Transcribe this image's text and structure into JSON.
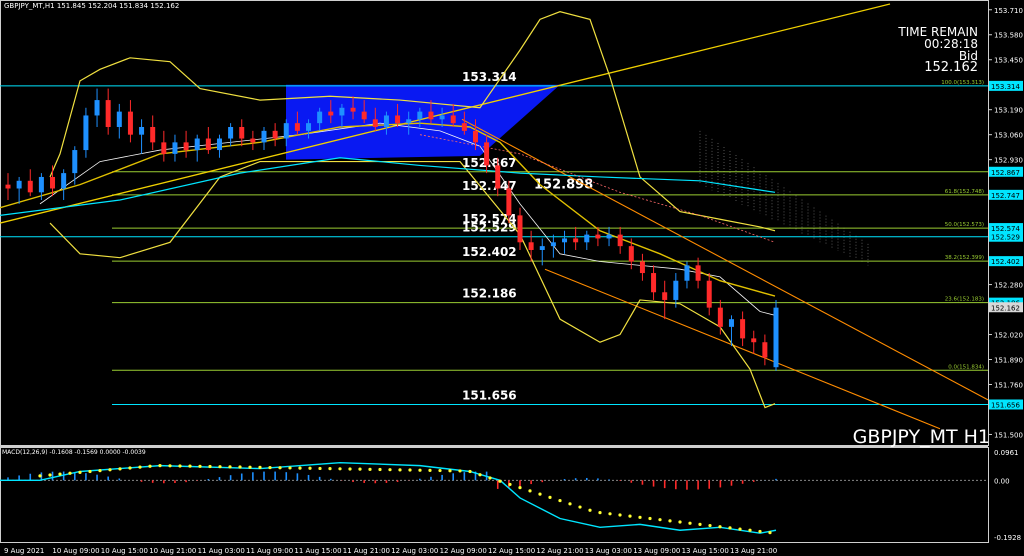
{
  "header": {
    "symbol_info": "GBPJPY_MT,H1  151.845 152.204 151.834 152.162"
  },
  "time_remain": {
    "label": "TIME REMAIN",
    "value": "00:28:18",
    "bid_label": "Bid",
    "bid_value": "152.162"
  },
  "symbol_title": "GBPJPY_MT H1",
  "price_callout": "152.898",
  "macd_header": "MACD(12,26,9) -0.1608 -0.1569 0.0000 -0.0039",
  "colors": {
    "background": "#000000",
    "bull_candle": "#1e90ff",
    "bear_candle": "#ff2a2a",
    "bollinger": "#f0e040",
    "level_line": "#9acd32",
    "cyan_line": "#00e5ff",
    "blue_zone": "#0a1aff",
    "trend_orange": "#ff8c00"
  },
  "chart_data": {
    "type": "candlestick",
    "price_axis": {
      "labels": [
        "153.710",
        "153.580",
        "153.450",
        "153.314",
        "153.190",
        "153.060",
        "152.930",
        "152.867",
        "152.747",
        "152.574",
        "152.529",
        "152.402",
        "152.280",
        "152.186",
        "152.020",
        "151.890",
        "151.760",
        "151.656",
        "151.500"
      ],
      "range": [
        151.44,
        153.74
      ]
    },
    "time_axis": [
      "9 Aug 2021",
      "10 Aug 09:00",
      "10 Aug 15:00",
      "10 Aug 21:00",
      "11 Aug 03:00",
      "11 Aug 09:00",
      "11 Aug 15:00",
      "11 Aug 21:00",
      "12 Aug 03:00",
      "12 Aug 09:00",
      "12 Aug 15:00",
      "12 Aug 21:00",
      "13 Aug 03:00",
      "13 Aug 09:00",
      "13 Aug 15:00",
      "13 Aug 21:00"
    ],
    "horizontal_levels": [
      {
        "value": 153.314,
        "label": "153.314",
        "color": "#00e5ff"
      },
      {
        "value": 152.867,
        "label": "152.867",
        "color": "#9acd32"
      },
      {
        "value": 152.747,
        "label": "152.747",
        "color": "#9acd32"
      },
      {
        "value": 152.574,
        "label": "152.574",
        "color": "#9acd32"
      },
      {
        "value": 152.529,
        "label": "152.529",
        "color": "#00e5ff"
      },
      {
        "value": 152.402,
        "label": "152.402",
        "color": "#9acd32"
      },
      {
        "value": 152.186,
        "label": "152.186",
        "color": "#9acd32"
      },
      {
        "value": 151.834,
        "label": "",
        "color": "#9acd32"
      },
      {
        "value": 151.656,
        "label": "151.656",
        "color": "#00e5ff"
      }
    ],
    "fib_labels": [
      {
        "value": 153.314,
        "label": "100.0(153.313)"
      },
      {
        "value": 152.747,
        "label": "61.8(152.748)"
      },
      {
        "value": 152.574,
        "label": "50.0(152.573)"
      },
      {
        "value": 152.402,
        "label": "38.2(152.399)"
      },
      {
        "value": 152.186,
        "label": "23.6(152.183)"
      },
      {
        "value": 151.834,
        "label": "0.0(151.834)"
      }
    ],
    "price_tags": [
      {
        "value": 153.314,
        "label": "153.314"
      },
      {
        "value": 152.867,
        "label": "152.867"
      },
      {
        "value": 152.747,
        "label": "152.747"
      },
      {
        "value": 152.574,
        "label": "152.574"
      },
      {
        "value": 152.529,
        "label": "152.529"
      },
      {
        "value": 152.402,
        "label": "152.402"
      },
      {
        "value": 152.186,
        "label": "152.186"
      },
      {
        "value": 151.656,
        "label": "151.656"
      }
    ],
    "candles": [
      [
        152.8,
        152.86,
        152.72,
        152.78
      ],
      [
        152.78,
        152.84,
        152.7,
        152.82
      ],
      [
        152.82,
        152.88,
        152.74,
        152.76
      ],
      [
        152.76,
        152.86,
        152.72,
        152.84
      ],
      [
        152.84,
        152.9,
        152.74,
        152.78
      ],
      [
        152.78,
        152.88,
        152.72,
        152.86
      ],
      [
        152.86,
        153.0,
        152.8,
        152.98
      ],
      [
        152.98,
        153.2,
        152.94,
        153.16
      ],
      [
        153.16,
        153.3,
        153.1,
        153.24
      ],
      [
        153.24,
        153.3,
        153.06,
        153.1
      ],
      [
        153.1,
        153.22,
        153.04,
        153.18
      ],
      [
        153.18,
        153.24,
        153.02,
        153.06
      ],
      [
        153.06,
        153.14,
        152.96,
        153.1
      ],
      [
        153.1,
        153.16,
        152.98,
        153.02
      ],
      [
        153.02,
        153.08,
        152.92,
        152.96
      ],
      [
        152.96,
        153.06,
        152.92,
        153.02
      ],
      [
        153.02,
        153.08,
        152.94,
        152.98
      ],
      [
        152.98,
        153.06,
        152.92,
        153.04
      ],
      [
        153.04,
        153.1,
        152.96,
        152.98
      ],
      [
        152.98,
        153.06,
        152.94,
        153.04
      ],
      [
        153.04,
        153.12,
        153.0,
        153.1
      ],
      [
        153.1,
        153.14,
        153.0,
        153.04
      ],
      [
        153.04,
        153.08,
        152.98,
        153.02
      ],
      [
        153.02,
        153.1,
        152.98,
        153.08
      ],
      [
        153.08,
        153.12,
        153.0,
        153.04
      ],
      [
        153.04,
        153.14,
        153.0,
        153.12
      ],
      [
        153.12,
        153.18,
        153.06,
        153.08
      ],
      [
        153.08,
        153.14,
        153.04,
        153.12
      ],
      [
        153.12,
        153.2,
        153.08,
        153.18
      ],
      [
        153.18,
        153.24,
        153.12,
        153.16
      ],
      [
        153.16,
        153.22,
        153.1,
        153.2
      ],
      [
        153.2,
        153.26,
        153.14,
        153.18
      ],
      [
        153.18,
        153.24,
        153.12,
        153.14
      ],
      [
        153.14,
        153.2,
        153.08,
        153.1
      ],
      [
        153.1,
        153.18,
        153.06,
        153.16
      ],
      [
        153.16,
        153.22,
        153.1,
        153.12
      ],
      [
        153.12,
        153.18,
        153.06,
        153.14
      ],
      [
        153.14,
        153.2,
        153.1,
        153.18
      ],
      [
        153.18,
        153.24,
        153.12,
        153.14
      ],
      [
        153.14,
        153.2,
        153.1,
        153.16
      ],
      [
        153.16,
        153.22,
        153.1,
        153.12
      ],
      [
        153.12,
        153.18,
        153.06,
        153.08
      ],
      [
        153.08,
        153.14,
        152.98,
        153.02
      ],
      [
        153.02,
        153.06,
        152.86,
        152.9
      ],
      [
        152.9,
        152.94,
        152.74,
        152.78
      ],
      [
        152.78,
        152.82,
        152.6,
        152.64
      ],
      [
        152.64,
        152.68,
        152.46,
        152.5
      ],
      [
        152.5,
        152.56,
        152.4,
        152.46
      ],
      [
        152.46,
        152.52,
        152.38,
        152.48
      ],
      [
        152.48,
        152.54,
        152.42,
        152.5
      ],
      [
        152.5,
        152.56,
        152.44,
        152.52
      ],
      [
        152.52,
        152.58,
        152.46,
        152.5
      ],
      [
        152.5,
        152.56,
        152.46,
        152.54
      ],
      [
        152.54,
        152.58,
        152.48,
        152.52
      ],
      [
        152.52,
        152.58,
        152.48,
        152.54
      ],
      [
        152.54,
        152.58,
        152.44,
        152.48
      ],
      [
        152.48,
        152.52,
        152.36,
        152.4
      ],
      [
        152.4,
        152.44,
        152.3,
        152.34
      ],
      [
        152.34,
        152.38,
        152.2,
        152.24
      ],
      [
        152.24,
        152.3,
        152.1,
        152.2
      ],
      [
        152.2,
        152.34,
        152.16,
        152.3
      ],
      [
        152.3,
        152.4,
        152.26,
        152.38
      ],
      [
        152.38,
        152.42,
        152.26,
        152.3
      ],
      [
        152.3,
        152.34,
        152.12,
        152.16
      ],
      [
        152.16,
        152.2,
        152.02,
        152.06
      ],
      [
        152.06,
        152.12,
        151.96,
        152.1
      ],
      [
        152.1,
        152.14,
        151.96,
        152.0
      ],
      [
        152.0,
        152.04,
        151.92,
        151.98
      ],
      [
        151.98,
        152.02,
        151.86,
        151.9
      ],
      [
        151.85,
        152.2,
        151.83,
        152.16
      ]
    ],
    "macd_panel": {
      "axis_labels": [
        "0.0961",
        "0.00",
        "-0.1928"
      ],
      "range": [
        -0.21,
        0.11
      ]
    }
  }
}
